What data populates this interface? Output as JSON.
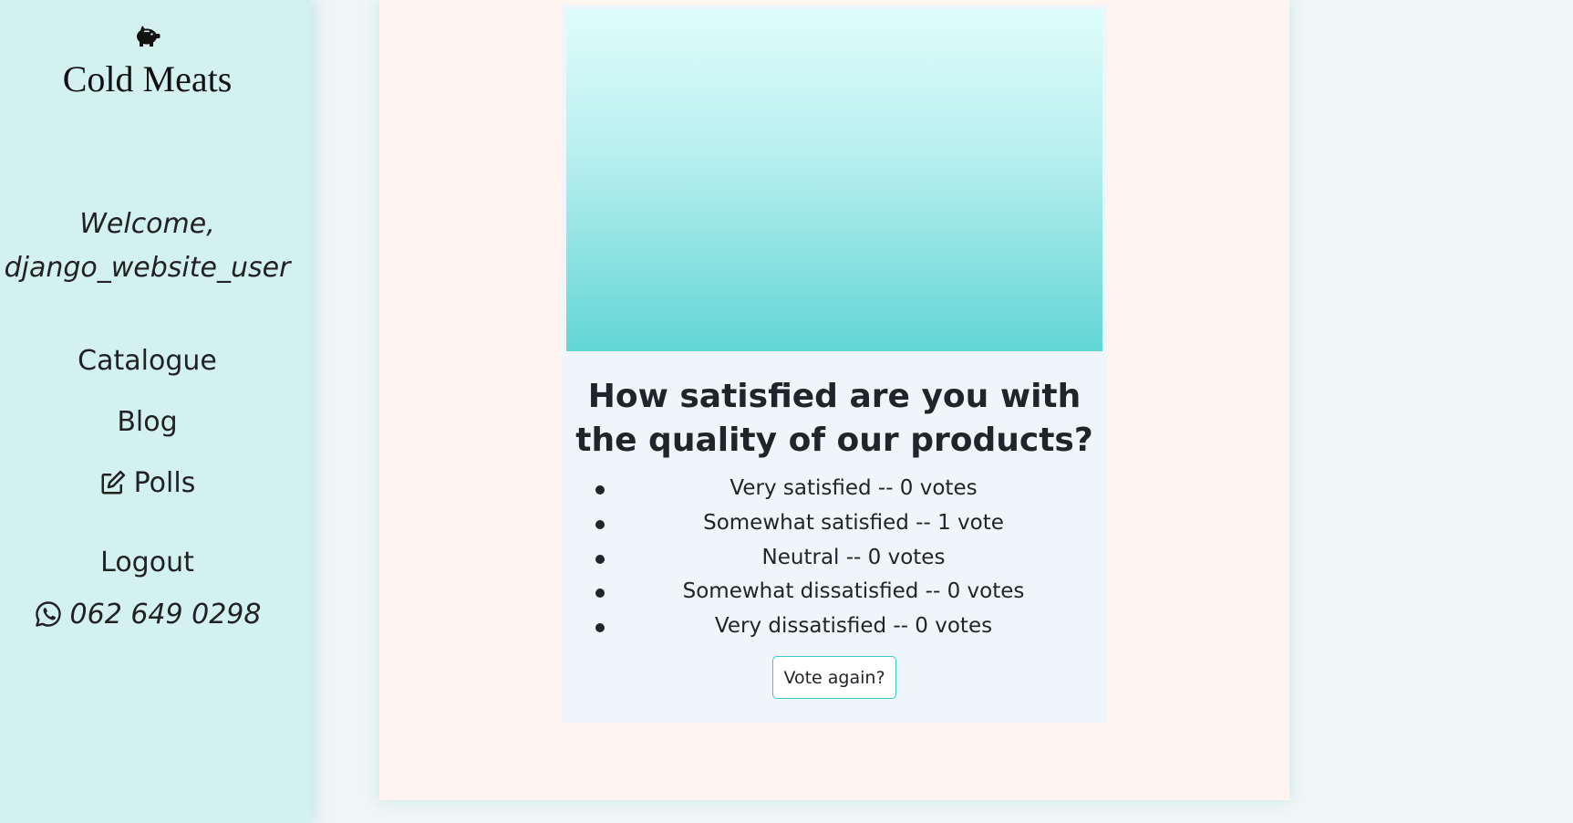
{
  "sidebar": {
    "brand_icon": "piggy-bank-icon",
    "brand": "Cold Meats",
    "welcome_line1": "Welcome,",
    "welcome_line2": "django_website_user",
    "nav": {
      "catalogue": "Catalogue",
      "blog": "Blog",
      "polls": "Polls",
      "polls_icon": "pencil-square-icon",
      "logout": "Logout"
    },
    "phone_icon": "whatsapp-icon",
    "phone": "062 649 0298"
  },
  "poll": {
    "question": "How satisfied are you with the quality of our products?",
    "choices": [
      "Very satisfied -- 0 votes",
      "Somewhat satisfied -- 1 vote",
      "Neutral -- 0 votes",
      "Somewhat dissatisfied -- 0 votes",
      "Very dissatisfied -- 0 votes"
    ],
    "vote_again_label": "Vote again?"
  },
  "colors": {
    "sidebar_bg": "#d3f1ef",
    "main_bg": "#fff4ef",
    "card_bg": "#eef6fc",
    "accent": "#3cc8c8"
  }
}
